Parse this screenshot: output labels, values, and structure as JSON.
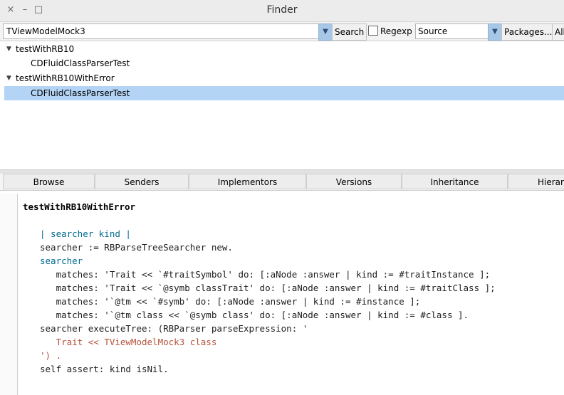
{
  "window": {
    "title": "Finder",
    "controls": [
      "×",
      "–",
      "□"
    ]
  },
  "toolbar": {
    "search_value": "TViewModelMock3",
    "search_button": "Search",
    "regexp_label": "Regexp",
    "regexp_checked": false,
    "mode_value": "Source",
    "packages_button": "Packages...",
    "all_button": "All"
  },
  "tree": {
    "rows": [
      {
        "label": "testWithRB10",
        "expanded": true,
        "selected": false
      },
      {
        "label": "CDFluidClassParserTest",
        "selected": false
      },
      {
        "label": "testWithRB10WithError",
        "expanded": true,
        "selected": false
      },
      {
        "label": "CDFluidClassParserTest",
        "selected": true
      }
    ]
  },
  "tabs": [
    "Browse",
    "Senders",
    "Implementors",
    "Versions",
    "Inheritance",
    "Hierarc"
  ],
  "code": {
    "method_name": "testWithRB10WithError",
    "lines": [
      "| searcher kind |",
      "searcher := RBParseTreeSearcher new.",
      "searcher",
      "   matches: 'Trait << `#traitSymbol' do: [:aNode :answer | kind := #traitInstance ];",
      "   matches: 'Trait << `@symb classTrait' do: [:aNode :answer | kind := #traitClass ];",
      "   matches: '`@tm << `#symb' do: [:aNode :answer | kind := #instance ];",
      "   matches: '`@tm class << `@symb class' do: [:aNode :answer | kind := #class ].",
      "searcher executeTree: (RBParser parseExpression: '",
      "   Trait << TViewModelMock3 class",
      "') .",
      "self assert: kind isNil."
    ]
  },
  "colors": {
    "selection": "#b3d4f5",
    "dropdown_button": "#a7c7e7",
    "keyword": "#006b8f",
    "string": "#b4513a"
  }
}
